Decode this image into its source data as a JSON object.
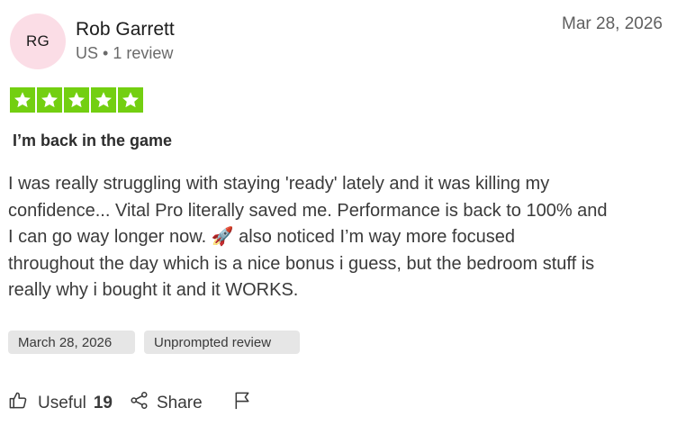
{
  "reviewer": {
    "initials": "RG",
    "name": "Rob Garrett",
    "country": "US",
    "separator": "•",
    "review_count": "1 review"
  },
  "date": "Mar 28, 2026",
  "rating": {
    "value": 5,
    "max": 5,
    "color": "#73cf11"
  },
  "review": {
    "title": "I’m back in the game",
    "body": "I was really struggling with staying 'ready' lately and it was killing my\nconfidence... Vital Pro literally saved me. Performance is back to 100% and\nI can go way longer now. 🚀 also noticed I’m way more focused\nthroughout the day which is a nice bonus i guess, but the bedroom stuff is\nreally why i bought it and it WORKS."
  },
  "tags": {
    "date_of_experience": "March 28, 2026",
    "unprompted": "Unprompted review"
  },
  "actions": {
    "useful_label": "Useful",
    "useful_count": "19",
    "share_label": "Share",
    "useful_icon": "thumbs-up-icon",
    "share_icon": "share-icon",
    "flag_icon": "flag-icon"
  },
  "colors": {
    "avatar_bg": "#fbdde6",
    "tag_bg": "#e6e6e6"
  }
}
